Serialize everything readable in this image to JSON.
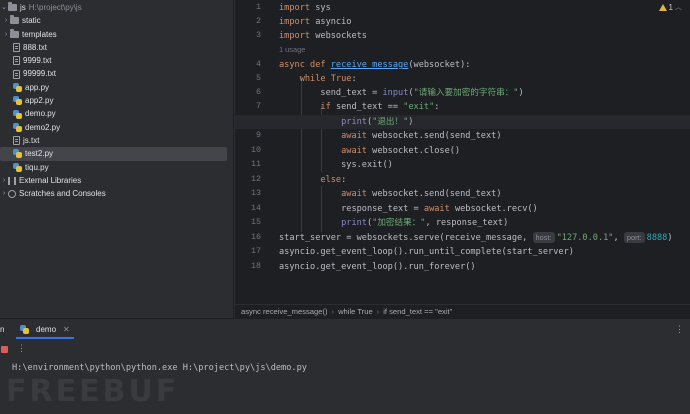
{
  "project_tree": {
    "root": {
      "name": "js",
      "path": "H:\\project\\py\\js"
    },
    "items": [
      {
        "label": "static",
        "kind": "folder"
      },
      {
        "label": "templates",
        "kind": "folder"
      },
      {
        "label": "888.txt",
        "kind": "txt"
      },
      {
        "label": "9999.txt",
        "kind": "txt"
      },
      {
        "label": "99999.txt",
        "kind": "txt"
      },
      {
        "label": "app.py",
        "kind": "py"
      },
      {
        "label": "app2.py",
        "kind": "py"
      },
      {
        "label": "demo.py",
        "kind": "py"
      },
      {
        "label": "demo2.py",
        "kind": "py"
      },
      {
        "label": "js.txt",
        "kind": "txt"
      },
      {
        "label": "test2.py",
        "kind": "py"
      },
      {
        "label": "tiqu.py",
        "kind": "py"
      }
    ],
    "external_libraries": "External Libraries",
    "scratches": "Scratches and Consoles"
  },
  "editor": {
    "warnings_count": "1",
    "current_line": "8",
    "line_numbers": [
      "1",
      "2",
      "3",
      "4",
      "5",
      "6",
      "7",
      "8",
      "9",
      "10",
      "11",
      "12",
      "13",
      "14",
      "15",
      "16",
      "17",
      "18"
    ],
    "usage_hint": "1 usage",
    "code": {
      "l1_kw": "import",
      "l1_rest": " sys",
      "l2_kw": "import",
      "l2_rest": " asyncio",
      "l3_kw": "import",
      "l3_rest": " websockets",
      "l4_kw": "async def ",
      "l4_fn": "receive_message",
      "l4_rest": "(websocket):",
      "l5_kw": "while True",
      "l5_rest": ":",
      "l6_a": "send_text = ",
      "l6_bi": "input",
      "l6_b": "(",
      "l6_str": "\"请输入要加密的字符串：\"",
      "l6_c": ")",
      "l7_kw": "if",
      "l7_a": " send_text == ",
      "l7_str": "\"exit\"",
      "l7_b": ":",
      "l8_bi": "print",
      "l8_a": "(",
      "l8_str": "\"退出！\"",
      "l8_b": ")",
      "l9_kw": "await",
      "l9_rest": " websocket.send(send_text)",
      "l10_kw": "await",
      "l10_rest": " websocket.close()",
      "l11_rest": "sys.exit()",
      "l12_kw": "else",
      "l12_rest": ":",
      "l13_kw": "await",
      "l13_rest": " websocket.send(send_text)",
      "l14_a": "response_text = ",
      "l14_kw": "await",
      "l14_rest": " websocket.recv()",
      "l15_bi": "print",
      "l15_a": "(",
      "l15_str": "\"加密结果：\"",
      "l15_b": ", response_text)",
      "l16_a": "start_server = websockets.serve(receive_message, ",
      "l16_hint_host": "host:",
      "l16_str": "\"127.0.0.1\"",
      "l16_b": ", ",
      "l16_hint_port": "port:",
      "l16_num": "8888",
      "l16_c": ")",
      "l17": "asyncio.get_event_loop().run_until_complete(start_server)",
      "l18": "asyncio.get_event_loop().run_forever()"
    }
  },
  "breadcrumb": [
    "async receive_message()",
    "while True",
    "if send_text == \"exit\""
  ],
  "run_panel": {
    "title": "n",
    "tab_label": "demo",
    "command": "H:\\environment\\python\\python.exe H:\\project\\py\\js\\demo.py",
    "watermark": "FREEBUF"
  }
}
